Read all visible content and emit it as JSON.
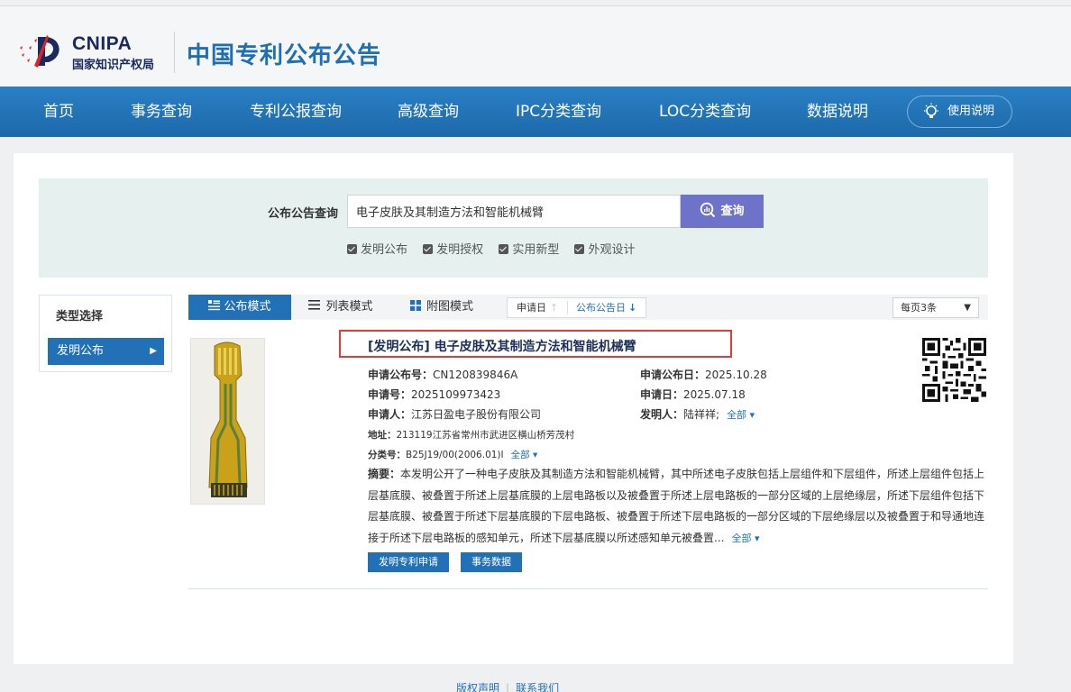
{
  "header": {
    "logo_text": "CNIPA",
    "logo_subtitle": "国家知识产权局",
    "site_title": "中国专利公布公告"
  },
  "nav": {
    "items": [
      "首页",
      "事务查询",
      "专利公报查询",
      "高级查询",
      "IPC分类查询",
      "LOC分类查询",
      "数据说明"
    ],
    "help_label": "使用说明"
  },
  "search": {
    "label": "公布公告查询",
    "query": "电子皮肤及其制造方法和智能机械臂",
    "button_label": "查询",
    "checkboxes": [
      {
        "label": "发明公布",
        "checked": true
      },
      {
        "label": "发明授权",
        "checked": true
      },
      {
        "label": "实用新型",
        "checked": true
      },
      {
        "label": "外观设计",
        "checked": true
      }
    ]
  },
  "sidebar": {
    "title": "类型选择",
    "items": [
      {
        "label": "发明公布"
      }
    ]
  },
  "modes": {
    "items": [
      "公布模式",
      "列表模式",
      "附图模式"
    ],
    "active": "公布模式",
    "sort": [
      "申请日",
      "公布公告日"
    ],
    "per_page": "每页3条"
  },
  "result": {
    "title": "[发明公布] 电子皮肤及其制造方法和智能机械臂",
    "pub_no_label": "申请公布号：",
    "pub_no": "CN120839846A",
    "pub_date_label": "申请公布日：",
    "pub_date": "2025.10.28",
    "app_no_label": "申请号：",
    "app_no": "2025109973423",
    "app_date_label": "申请日：",
    "app_date": "2025.07.18",
    "applicant_label": "申请人：",
    "applicant": "江苏日盈电子股份有限公司",
    "inventor_label": "发明人：",
    "inventor": "陆祥祥;",
    "all_label": "全部",
    "address_label": "地址：",
    "address": "213119江苏省常州市武进区横山桥芳茂村",
    "class_label": "分类号：",
    "class_no": "B25J19/00(2006.01)I",
    "abstract_label": "摘要：",
    "abstract": "本发明公开了一种电子皮肤及其制造方法和智能机械臂，其中所述电子皮肤包括上层组件和下层组件，所述上层组件包括上层基底膜、被叠置于所述上层基底膜的上层电路板以及被叠置于所述上层电路板的一部分区域的上层绝缘层，所述下层组件包括下层基底膜、被叠置于所述下层基底膜的下层电路板、被叠置于所述下层电路板的一部分区域的下层绝缘层以及被叠置于和导通地连接于所述下层电路板的感知单元，所述下层基底膜以所述感知单元被叠置...",
    "buttons": [
      "发明专利申请",
      "事务数据"
    ]
  },
  "footer": {
    "links": [
      "版权声明",
      "联系我们"
    ]
  },
  "colors": {
    "nav": "#1f74b8",
    "accent": "#2271b8",
    "search_button": "#6f72c9",
    "highlight_box": "#e53a3a"
  }
}
